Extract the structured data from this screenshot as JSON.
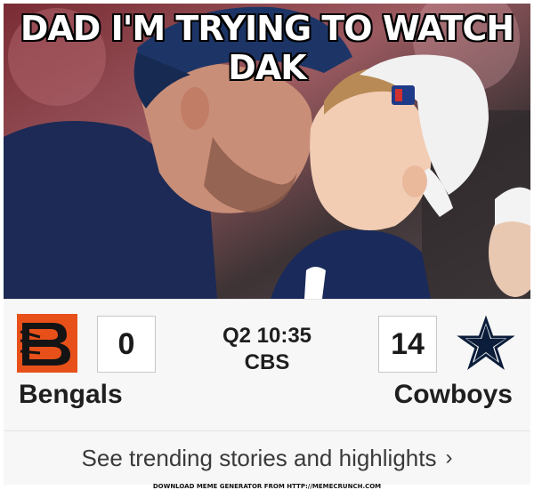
{
  "meme": {
    "caption": "DAD I'M TRYING TO WATCH DAK"
  },
  "scoreboard": {
    "away_team": {
      "name": "Bengals",
      "score": "0",
      "logo_text": "B"
    },
    "home_team": {
      "name": "Cowboys",
      "score": "14"
    },
    "game": {
      "period_clock": "Q2 10:35",
      "network": "CBS"
    }
  },
  "trending": {
    "label": "See trending stories and highlights",
    "chevron": "›"
  },
  "watermark": {
    "text": "DOWNLOAD MEME GENERATOR FROM HTTP://MEMECRUNCH.COM"
  },
  "colors": {
    "bengals_orange": "#e8501a",
    "bengals_black": "#141414",
    "cowboys_navy": "#0b1d3a",
    "shirt_navy": "#1c2a55"
  }
}
